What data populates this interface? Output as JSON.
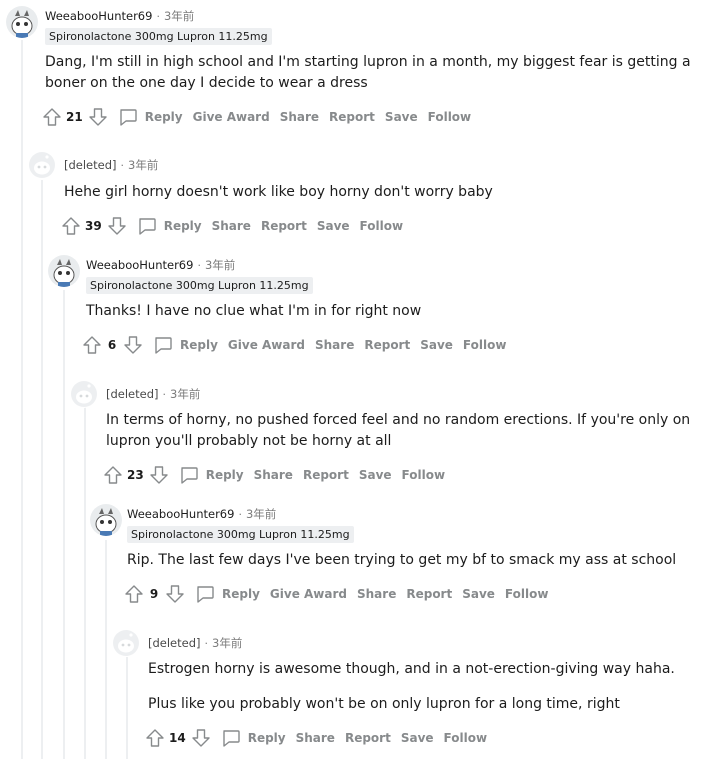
{
  "comments": [
    {
      "username": "WeeabooHunter69",
      "time": "3年前",
      "flair": "Spironolactone 300mg Lupron 11.25mg",
      "body": [
        "Dang, I'm still in high school and I'm starting lupron in a month, my biggest fear is getting a boner on the one day I decide to wear a dress"
      ],
      "score": "21",
      "actions": {
        "reply": "Reply",
        "award": "Give Award",
        "share": "Share",
        "report": "Report",
        "save": "Save",
        "follow": "Follow"
      }
    },
    {
      "username": "[deleted]",
      "time": "3年前",
      "body": [
        "Hehe girl horny doesn't work like boy horny don't worry baby"
      ],
      "score": "39",
      "actions": {
        "reply": "Reply",
        "share": "Share",
        "report": "Report",
        "save": "Save",
        "follow": "Follow"
      }
    },
    {
      "username": "WeeabooHunter69",
      "time": "3年前",
      "flair": "Spironolactone 300mg Lupron 11.25mg",
      "body": [
        "Thanks! I have no clue what I'm in for right now"
      ],
      "score": "6",
      "actions": {
        "reply": "Reply",
        "award": "Give Award",
        "share": "Share",
        "report": "Report",
        "save": "Save",
        "follow": "Follow"
      }
    },
    {
      "username": "[deleted]",
      "time": "3年前",
      "body": [
        "In terms of horny, no pushed forced feel and no random erections. If you're only on lupron you'll probably not be horny at all"
      ],
      "score": "23",
      "actions": {
        "reply": "Reply",
        "share": "Share",
        "report": "Report",
        "save": "Save",
        "follow": "Follow"
      }
    },
    {
      "username": "WeeabooHunter69",
      "time": "3年前",
      "flair": "Spironolactone 300mg Lupron 11.25mg",
      "body": [
        "Rip. The last few days I've been trying to get my bf to smack my ass at school"
      ],
      "score": "9",
      "actions": {
        "reply": "Reply",
        "award": "Give Award",
        "share": "Share",
        "report": "Report",
        "save": "Save",
        "follow": "Follow"
      }
    },
    {
      "username": "[deleted]",
      "time": "3年前",
      "body": [
        "Estrogen horny is awesome though, and in a not-erection-giving way haha.",
        "Plus like you probably won't be on only lupron for a long time, right"
      ],
      "score": "14",
      "actions": {
        "reply": "Reply",
        "share": "Share",
        "report": "Report",
        "save": "Save",
        "follow": "Follow"
      }
    }
  ]
}
